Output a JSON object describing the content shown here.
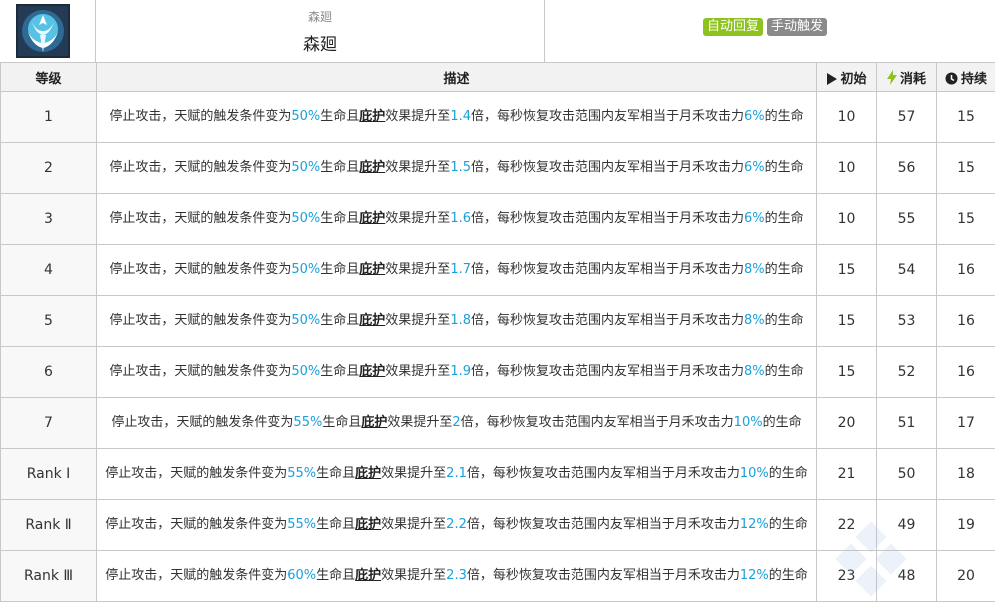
{
  "skill": {
    "name_small": "森廻",
    "name": "森廻",
    "icon": "skill-icon",
    "tags": [
      {
        "label": "自动回复",
        "color": "#8ec21f"
      },
      {
        "label": "手动触发",
        "color": "#8a8a8a"
      }
    ]
  },
  "table": {
    "headers": {
      "level": "等级",
      "desc": "描述",
      "init": "初始",
      "cost": "消耗",
      "duration": "持续"
    },
    "header_icons": {
      "init": "play-icon",
      "cost": "lightning-icon",
      "duration": "clock-icon"
    },
    "desc_parts": {
      "p1": "停止攻击，天赋的触发条件变为",
      "p2": "生命且",
      "keyword": "庇护",
      "p3": "效果提升至",
      "p4": "倍，每秒恢复攻击范围内友军相当于月禾攻击力",
      "p5": "的生命"
    },
    "rows": [
      {
        "level": "1",
        "cond": "50%",
        "mult": "1.4",
        "heal": "6%",
        "init": "10",
        "cost": "57",
        "duration": "15"
      },
      {
        "level": "2",
        "cond": "50%",
        "mult": "1.5",
        "heal": "6%",
        "init": "10",
        "cost": "56",
        "duration": "15"
      },
      {
        "level": "3",
        "cond": "50%",
        "mult": "1.6",
        "heal": "6%",
        "init": "10",
        "cost": "55",
        "duration": "15"
      },
      {
        "level": "4",
        "cond": "50%",
        "mult": "1.7",
        "heal": "8%",
        "init": "15",
        "cost": "54",
        "duration": "16"
      },
      {
        "level": "5",
        "cond": "50%",
        "mult": "1.8",
        "heal": "8%",
        "init": "15",
        "cost": "53",
        "duration": "16"
      },
      {
        "level": "6",
        "cond": "50%",
        "mult": "1.9",
        "heal": "8%",
        "init": "15",
        "cost": "52",
        "duration": "16"
      },
      {
        "level": "7",
        "cond": "55%",
        "mult": "2",
        "heal": "10%",
        "init": "20",
        "cost": "51",
        "duration": "17"
      },
      {
        "level": "Rank Ⅰ",
        "cond": "55%",
        "mult": "2.1",
        "heal": "10%",
        "init": "21",
        "cost": "50",
        "duration": "18"
      },
      {
        "level": "Rank Ⅱ",
        "cond": "55%",
        "mult": "2.2",
        "heal": "12%",
        "init": "22",
        "cost": "49",
        "duration": "19"
      },
      {
        "level": "Rank Ⅲ",
        "cond": "60%",
        "mult": "2.3",
        "heal": "12%",
        "init": "23",
        "cost": "48",
        "duration": "20"
      }
    ]
  },
  "colors": {
    "highlight": "#1aa0dc",
    "lightning": "#8ec21f",
    "header_bg": "#f2f2f2",
    "border": "#c8c8c8"
  }
}
